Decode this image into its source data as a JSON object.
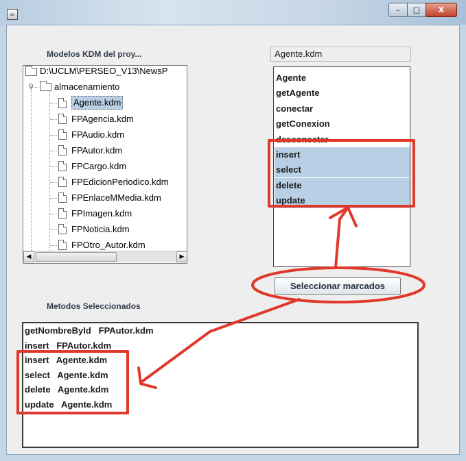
{
  "window": {
    "app_icon": "java-cup-icon",
    "controls": {
      "minimize": "–",
      "maximize": "□",
      "close": "X"
    }
  },
  "left": {
    "models_label": "Modelos KDM del proy...",
    "tree": {
      "root": "D:\\UCLM\\PERSEO_V13\\NewsP",
      "folder": "almacenamiento",
      "files": [
        "Agente.kdm",
        "FPAgencia.kdm",
        "FPAudio.kdm",
        "FPAutor.kdm",
        "FPCargo.kdm",
        "FPEdicionPeriodico.kdm",
        "FPEnlaceMMedia.kdm",
        "FPImagen.kdm",
        "FPNoticia.kdm",
        "FPOtro_Autor.kdm"
      ],
      "selected_file": "Agente.kdm"
    },
    "scroll": {
      "up": "▲",
      "down": "▼",
      "left": "◀",
      "right": "▶"
    }
  },
  "right": {
    "kdm_field_value": "Agente.kdm",
    "methods": [
      {
        "label": "Agente",
        "highlighted": false
      },
      {
        "label": "getAgente",
        "highlighted": false
      },
      {
        "label": "conectar",
        "highlighted": false
      },
      {
        "label": "getConexion",
        "highlighted": false
      },
      {
        "label": "desconectar",
        "highlighted": false
      },
      {
        "label": "insert",
        "highlighted": true
      },
      {
        "label": "select",
        "highlighted": true
      },
      {
        "label": "delete",
        "highlighted": true
      },
      {
        "label": "update",
        "highlighted": true
      }
    ],
    "select_button_label": "Seleccionar marcados"
  },
  "bottom": {
    "selected_label": "Metodos Seleccionados",
    "rows": [
      "getNombreById   FPAutor.kdm",
      "insert   FPAutor.kdm",
      "insert   Agente.kdm",
      "select   Agente.kdm",
      "delete   Agente.kdm",
      "update   Agente.kdm"
    ]
  },
  "annotation": {
    "color": "#e0382a"
  }
}
